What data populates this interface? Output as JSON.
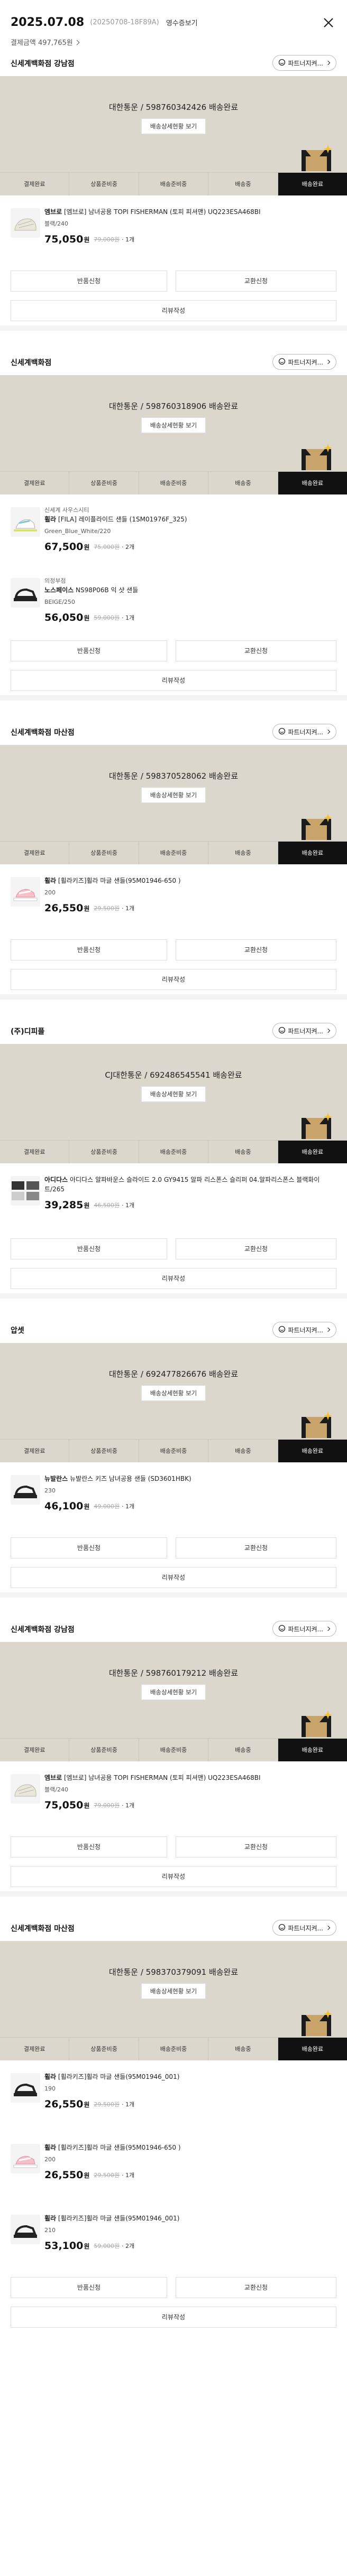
{
  "header": {
    "date": "2025.07.08",
    "order_number": "(20250708-18F89A)",
    "receipt_link": "영수증보기",
    "payment_label": "결제금액 497,765원"
  },
  "labels": {
    "contact": "파트너지켜...",
    "track": "배송상세현황 보기",
    "return": "반품신청",
    "exchange": "교환신청",
    "review": "리뷰작성",
    "won": "원",
    "steps": [
      "결제완료",
      "상품준비중",
      "배송준비중",
      "배송중",
      "배송완료"
    ]
  },
  "sections": [
    {
      "store": "신세계백화점 강남점",
      "delivery": "대한통운 / 598760342426 배송완료",
      "items": [
        {
          "pre_store": "",
          "brand": "엠브로",
          "name": "[엠브로] 남녀공용 TOPI FISHERMAN (토피 피셔맨) UQ223ESA468BI",
          "option": "블랙/240",
          "price": "75,050",
          "orig": "79,000원",
          "qty": "· 1개"
        }
      ]
    },
    {
      "store": "신세계백화점",
      "delivery": "대한통운 / 598760318906 배송완료",
      "items": [
        {
          "pre_store": "신세계 사우스시티",
          "brand": "휠라",
          "name": "[FILA] 레이플라이드 샌들 (1SM01976F_325)",
          "option": "Green_Blue_White/220",
          "price": "67,500",
          "orig": "75,000원",
          "qty": "· 2개"
        },
        {
          "pre_store": "의정부점",
          "brand": "노스페이스",
          "name": "NS98P06B 익 샷 샌들",
          "option": "BEIGE/250",
          "price": "56,050",
          "orig": "59,000원",
          "qty": "· 1개"
        }
      ]
    },
    {
      "store": "신세계백화점 마산점",
      "delivery": "대한통운 / 598370528062 배송완료",
      "items": [
        {
          "pre_store": "",
          "brand": "휠라",
          "name": "[휠라키즈]휠라 마글 샌들(95M01946-650 )",
          "option": "200",
          "price": "26,550",
          "orig": "29,500원",
          "qty": "· 1개"
        }
      ]
    },
    {
      "store": "(주)디피플",
      "delivery": "CJ대한통운 / 692486545541 배송완료",
      "items": [
        {
          "pre_store": "",
          "brand": "아디다스",
          "name": "아디다스 알파바운스 슬라이드 2.0 GY9415 알파 리스폰스 슬리퍼 04.알파리스폰스 블랙화이트/265",
          "option": "",
          "price": "39,285",
          "orig": "46,500원",
          "qty": "· 1개"
        }
      ]
    },
    {
      "store": "압셋",
      "delivery": "대한통운 / 692477826676 배송완료",
      "items": [
        {
          "pre_store": "",
          "brand": "뉴발란스",
          "name": "뉴발란스 키즈 남녀공용 샌들 (SD3601HBK)",
          "option": "230",
          "price": "46,100",
          "orig": "49,000원",
          "qty": "· 1개"
        }
      ]
    },
    {
      "store": "신세계백화점 강남점",
      "delivery": "대한통운 / 598760179212 배송완료",
      "items": [
        {
          "pre_store": "",
          "brand": "엠브로",
          "name": "[엠브로] 남녀공용 TOPI FISHERMAN (토피 피셔맨) UQ223ESA468BI",
          "option": "블랙/240",
          "price": "75,050",
          "orig": "79,000원",
          "qty": "· 1개"
        }
      ]
    },
    {
      "store": "신세계백화점 마산점",
      "delivery": "대한통운 / 598370379091 배송완료",
      "items": [
        {
          "pre_store": "",
          "brand": "휠라",
          "name": "[휠라키즈]휠라 마글 샌들(95M01946_001)",
          "option": "190",
          "price": "26,550",
          "orig": "29,500원",
          "qty": "· 1개"
        },
        {
          "pre_store": "",
          "brand": "휠라",
          "name": "[휠라키즈]휠라 마글 샌들(95M01946-650 )",
          "option": "200",
          "price": "26,550",
          "orig": "29,500원",
          "qty": "· 1개"
        },
        {
          "pre_store": "",
          "brand": "휠라",
          "name": "[휠라키즈]휠라 마글 샌들(95M01946_001)",
          "option": "210",
          "price": "53,100",
          "orig": "59,000원",
          "qty": "· 2개"
        }
      ]
    }
  ]
}
